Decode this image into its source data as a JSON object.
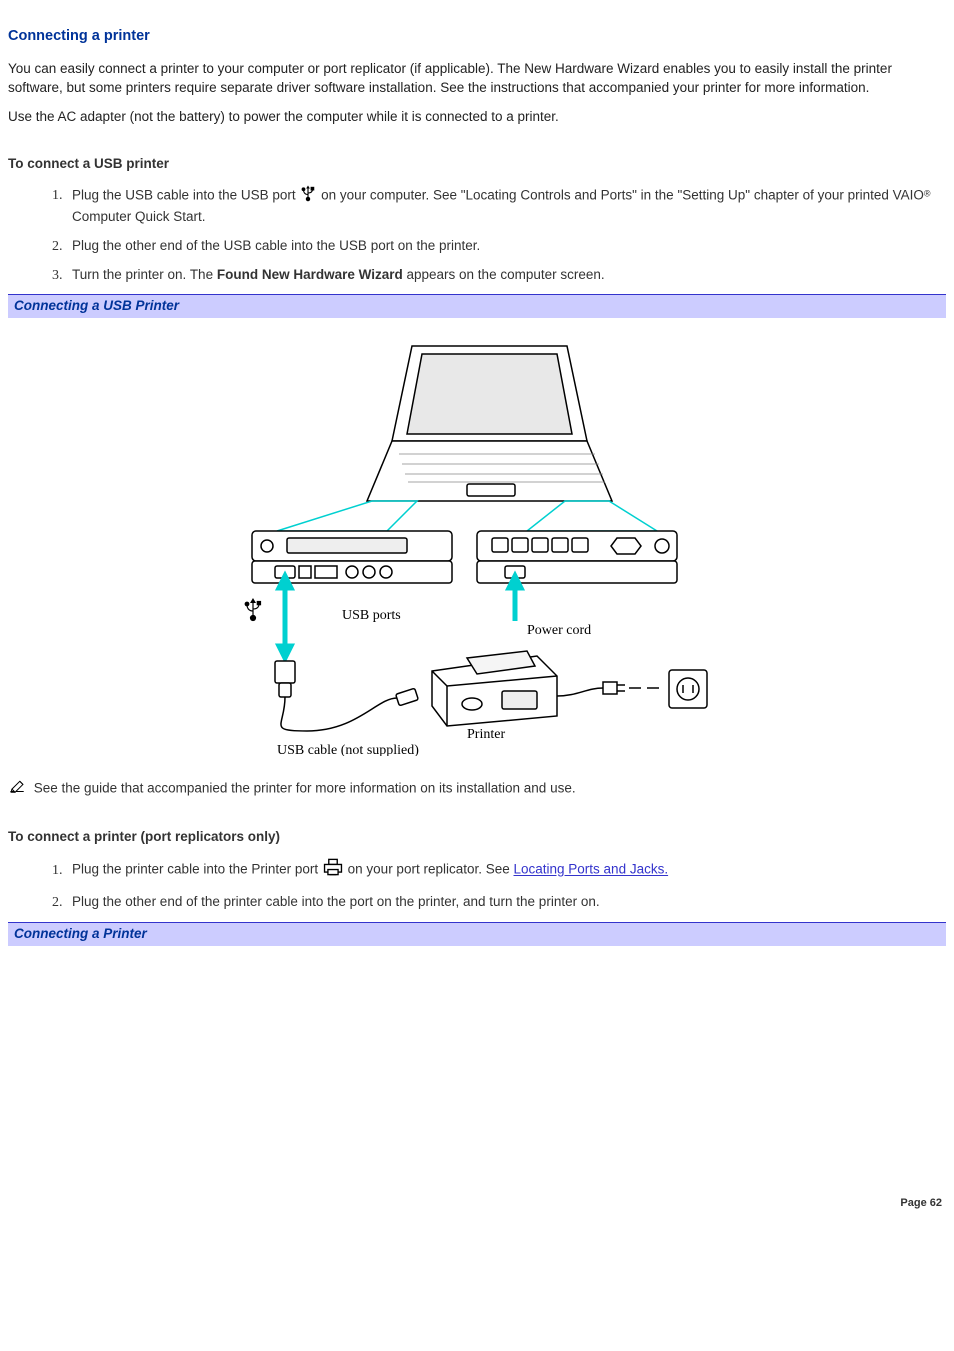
{
  "heading": "Connecting a printer",
  "intro_p1": "You can easily connect a printer to your computer or port replicator (if applicable). The New Hardware Wizard enables you to easily install the printer software, but some printers require separate driver software installation. See the instructions that accompanied your printer for more information.",
  "intro_p2": "Use the AC adapter (not the battery) to power the computer while it is connected to a printer.",
  "sub1": "To connect a USB printer",
  "s1_li1_a": "Plug the USB cable into the USB port ",
  "s1_li1_b": " on your computer. See \"Locating Controls and Ports\" in the \"Setting Up\" chapter of your printed VAIO",
  "s1_li1_c": " Computer Quick Start.",
  "reg": "®",
  "s1_li2": "Plug the other end of the USB cable into the USB port on the printer.",
  "s1_li3_a": "Turn the printer on. The ",
  "s1_li3_bold": "Found New Hardware Wizard",
  "s1_li3_b": " appears on the computer screen.",
  "cap1": "Connecting a USB Printer",
  "fig_labels": {
    "usb_ports": "USB ports",
    "power_cord": "Power cord",
    "printer": "Printer",
    "usb_cable": "USB cable (not supplied)"
  },
  "note": " See the guide that accompanied the printer for more information on its installation and use.",
  "sub2": "To connect a printer (port replicators only)",
  "s2_li1_a": "Plug the printer cable into the Printer port ",
  "s2_li1_b": " on your port replicator. See ",
  "s2_link": "Locating Ports and Jacks.",
  "s2_li2": "Plug the other end of the printer cable into the port on the printer, and turn the printer on.",
  "cap2": "Connecting a Printer",
  "page_num": "Page 62"
}
